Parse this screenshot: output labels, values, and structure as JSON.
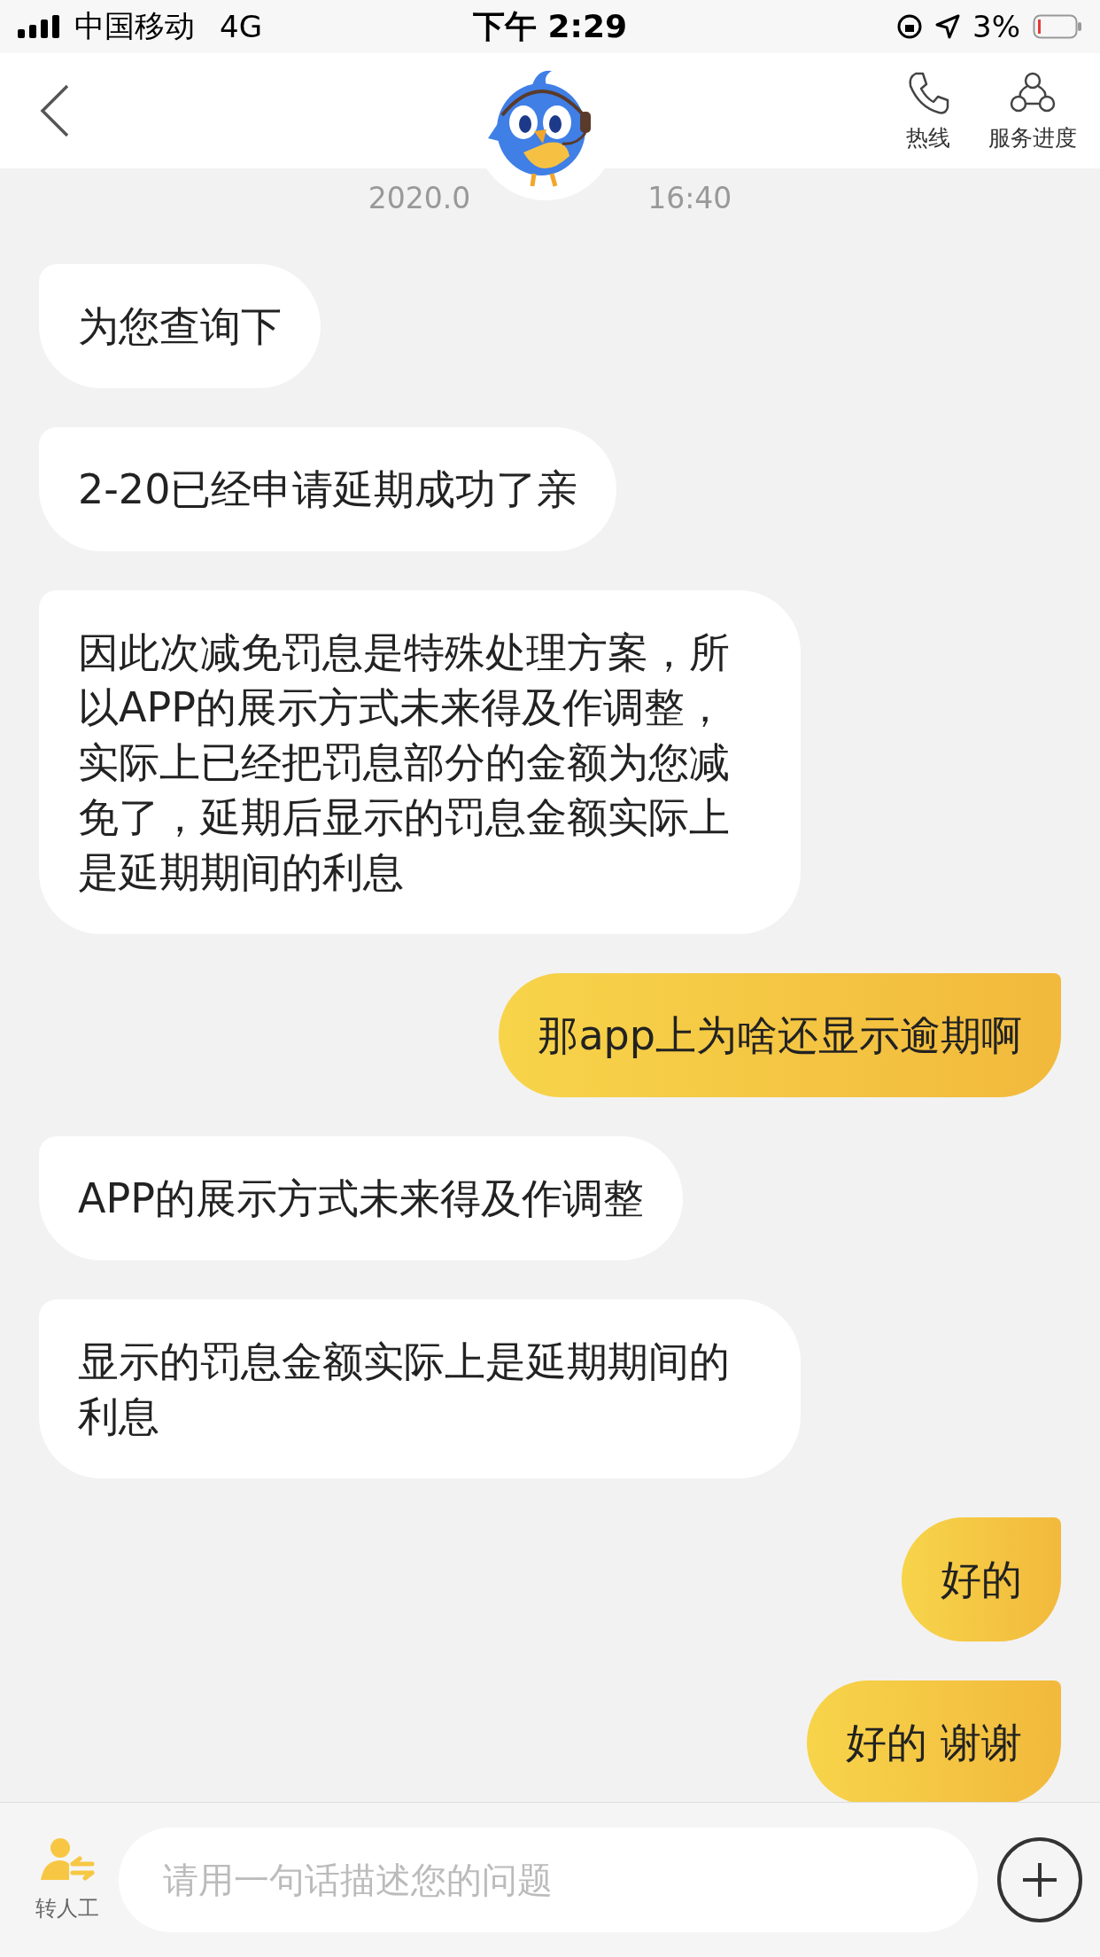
{
  "status_bar": {
    "carrier": "中国移动",
    "network": "4G",
    "time": "下午 2:29",
    "battery": "3%"
  },
  "header": {
    "actions": [
      {
        "kind": "phone",
        "label": "热线"
      },
      {
        "kind": "progress",
        "label": "服务进度"
      }
    ]
  },
  "timestamp": {
    "start": "2020.0",
    "end": "16:40"
  },
  "messages": [
    {
      "kind": "agent",
      "text": "为您查询下"
    },
    {
      "kind": "agent",
      "text": "2-20已经申请延期成功了亲"
    },
    {
      "kind": "agent",
      "text": "因此次减免罚息是特殊处理方案，所以APP的展示方式未来得及作调整，实际上已经把罚息部分的金额为您减免了，延期后显示的罚息金额实际上是延期期间的利息"
    },
    {
      "kind": "user",
      "text": "那app上为啥还显示逾期啊"
    },
    {
      "kind": "agent",
      "text": "APP的展示方式未来得及作调整"
    },
    {
      "kind": "agent",
      "text": "显示的罚息金额实际上是延期期间的利息"
    },
    {
      "kind": "user",
      "text": "好的"
    },
    {
      "kind": "user",
      "text": "好的 谢谢"
    }
  ],
  "input_bar": {
    "transfer_label": "转人工",
    "placeholder": "请用一句话描述您的问题"
  }
}
